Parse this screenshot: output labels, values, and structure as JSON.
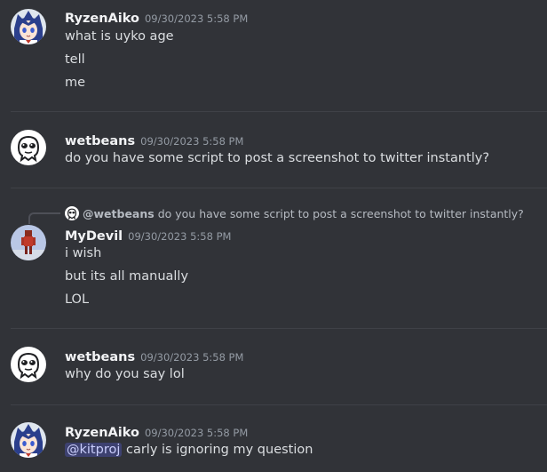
{
  "colors": {
    "background": "#313338",
    "username": "#f2f3f5",
    "text": "#dbdee1",
    "timestamp": "#949ba4",
    "mention_text": "#c9cdfb",
    "divider": "#3f4147"
  },
  "messages": [
    {
      "username": "RyzenAiko",
      "timestamp": "09/30/2023 5:58 PM",
      "avatar_icon": "anime-girl-avatar-icon",
      "lines": [
        "what is uyko age",
        "tell",
        "me"
      ]
    },
    {
      "username": "wetbeans",
      "timestamp": "09/30/2023 5:58 PM",
      "avatar_icon": "cartoon-face-avatar-icon",
      "lines": [
        "do you have some script to post a screenshot to twitter instantly?"
      ]
    },
    {
      "reply": {
        "mention": "@wetbeans",
        "text": "do you have some script to post a screenshot to twitter instantly?"
      },
      "username": "MyDevil",
      "timestamp": "09/30/2023 5:58 PM",
      "avatar_icon": "red-figure-avatar-icon",
      "lines": [
        "i wish",
        "but its all manually",
        "LOL"
      ]
    },
    {
      "username": "wetbeans",
      "timestamp": "09/30/2023 5:58 PM",
      "avatar_icon": "cartoon-face-avatar-icon",
      "lines": [
        "why do you say lol"
      ]
    },
    {
      "username": "RyzenAiko",
      "timestamp": "09/30/2023 5:58 PM",
      "avatar_icon": "anime-girl-avatar-icon",
      "mention": "@kitproj",
      "text_after_mention": " carly is ignoring my question"
    }
  ]
}
